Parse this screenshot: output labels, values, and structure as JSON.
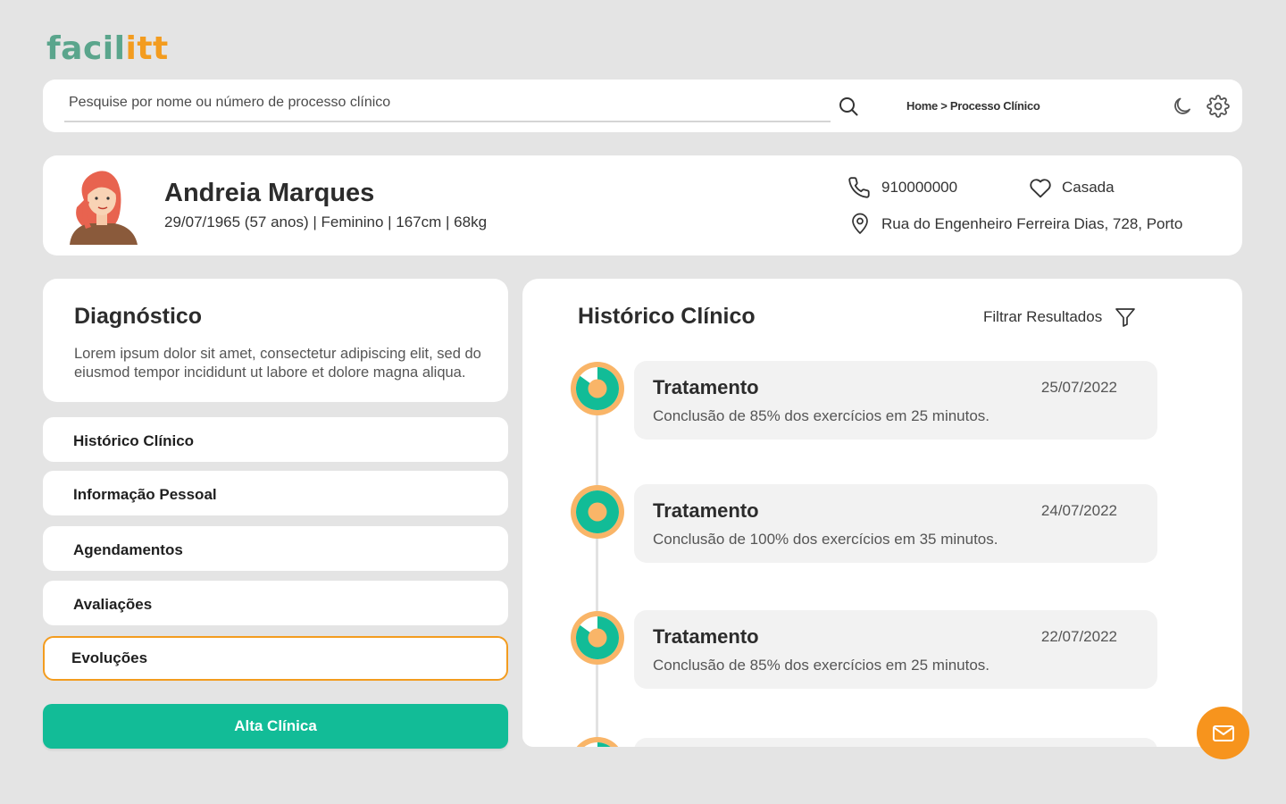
{
  "logo": {
    "part1": "facil",
    "part2": "itt"
  },
  "search": {
    "placeholder": "Pesquise por nome ou número de processo clínico"
  },
  "breadcrumb": "Home > Processo Clínico",
  "icons": {
    "search": "search-icon",
    "moon": "moon-icon",
    "gear": "gear-icon",
    "phone": "phone-icon",
    "heart": "heart-icon",
    "pin": "location-pin-icon",
    "filter": "filter-icon",
    "mail": "mail-icon"
  },
  "patient": {
    "name": "Andreia Marques",
    "info": "29/07/1965 (57 anos) | Feminino | 167cm | 68kg",
    "phone": "910000000",
    "marital_status": "Casada",
    "address": "Rua do Engenheiro Ferreira Dias, 728, Porto"
  },
  "diagnosis": {
    "title": "Diagnóstico",
    "text": "Lorem ipsum dolor sit amet, consectetur adipiscing elit, sed do eiusmod tempor incididunt ut labore et dolore magna aliqua."
  },
  "nav": [
    {
      "label": "Histórico Clínico",
      "active": false
    },
    {
      "label": "Informação Pessoal",
      "active": false
    },
    {
      "label": "Agendamentos",
      "active": false
    },
    {
      "label": "Avaliações",
      "active": false
    },
    {
      "label": "Evoluções",
      "active": true
    }
  ],
  "discharge_button": "Alta Clínica",
  "history": {
    "title": "Histórico Clínico",
    "filter_label": "Filtrar Resultados",
    "entries": [
      {
        "title": "Tratamento",
        "date": "25/07/2022",
        "desc": "Conclusão de 85% dos exercícios em 25 minutos.",
        "progress": 0.85
      },
      {
        "title": "Tratamento",
        "date": "24/07/2022",
        "desc": "Conclusão de 100% dos exercícios em 35 minutos.",
        "progress": 1.0
      },
      {
        "title": "Tratamento",
        "date": "22/07/2022",
        "desc": "Conclusão de 85% dos exercícios em 25 minutos.",
        "progress": 0.85
      }
    ]
  },
  "colors": {
    "accent_green": "#12bc97",
    "accent_orange": "#f7941d",
    "logo_green": "#5aa58c",
    "background": "#e4e4e4"
  }
}
